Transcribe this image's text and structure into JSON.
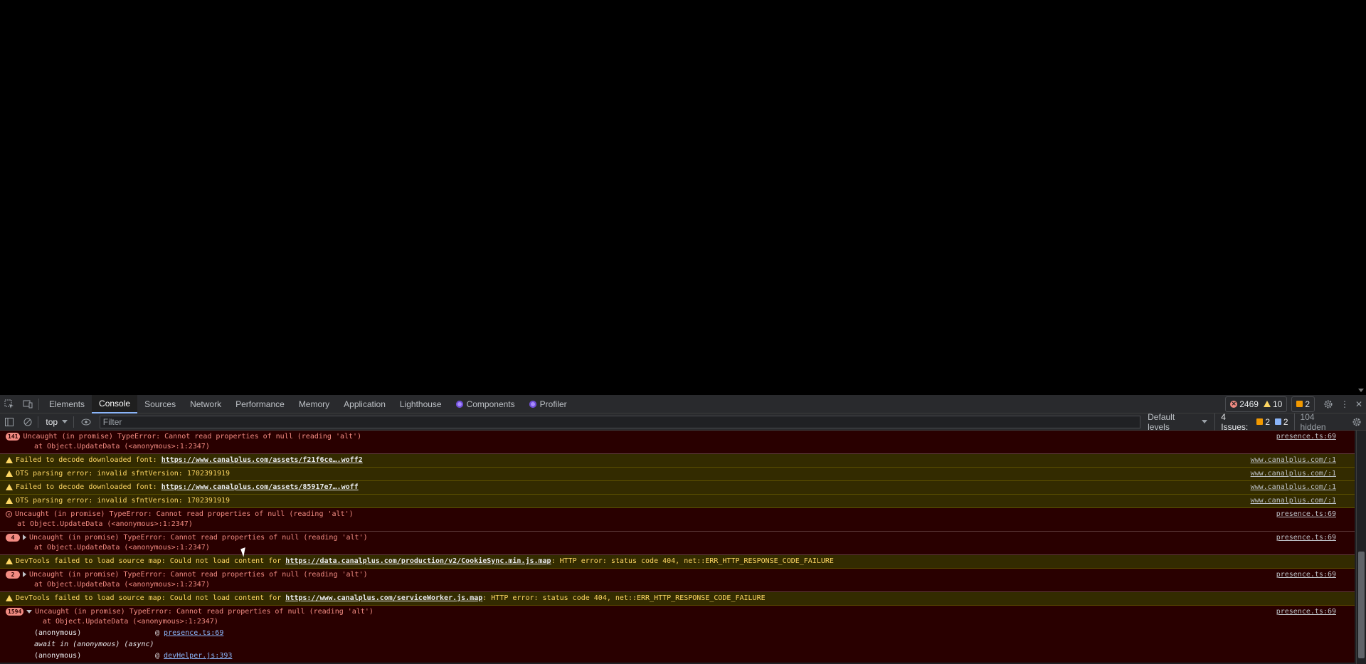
{
  "tabs": [
    {
      "label": "Elements",
      "active": false
    },
    {
      "label": "Console",
      "active": true
    },
    {
      "label": "Sources",
      "active": false
    },
    {
      "label": "Network",
      "active": false
    },
    {
      "label": "Performance",
      "active": false
    },
    {
      "label": "Memory",
      "active": false
    },
    {
      "label": "Application",
      "active": false
    },
    {
      "label": "Lighthouse",
      "active": false
    },
    {
      "label": "Components",
      "active": false
    },
    {
      "label": "Profiler",
      "active": false
    }
  ],
  "counters": {
    "errors": "2469",
    "warnings": "10",
    "issues": "2"
  },
  "toolbar": {
    "context": "top",
    "filter_placeholder": "Filter",
    "levels": "Default levels",
    "issues_label": "4 Issues:",
    "issues_warn": "2",
    "issues_info": "2",
    "hidden": "104 hidden"
  },
  "messages": [
    {
      "type": "error",
      "badge": "141",
      "text": "Uncaught (in promise) TypeError: Cannot read properties of null (reading 'alt')",
      "sub": "at Object.UpdateData (<anonymous>:1:2347)",
      "src": "presence.ts:69"
    },
    {
      "type": "warning",
      "pre": "Failed to decode downloaded font: ",
      "link": "https://www.canalplus.com/assets/f21f6ce….woff2",
      "post": "",
      "src": "www.canalplus.com/:1"
    },
    {
      "type": "warning",
      "pre": "OTS parsing error: invalid sfntVersion: 1702391919",
      "link": "",
      "post": "",
      "src": "www.canalplus.com/:1"
    },
    {
      "type": "warning",
      "pre": "Failed to decode downloaded font: ",
      "link": "https://www.canalplus.com/assets/85917e7….woff",
      "post": "",
      "src": "www.canalplus.com/:1"
    },
    {
      "type": "warning",
      "pre": "OTS parsing error: invalid sfntVersion: 1702391919",
      "link": "",
      "post": "",
      "src": "www.canalplus.com/:1"
    },
    {
      "type": "error",
      "icon": true,
      "text": "Uncaught (in promise) TypeError: Cannot read properties of null (reading 'alt')",
      "sub": "at Object.UpdateData (<anonymous>:1:2347)",
      "src": "presence.ts:69"
    },
    {
      "type": "error",
      "badge": "4",
      "tri": true,
      "text": "Uncaught (in promise) TypeError: Cannot read properties of null (reading 'alt')",
      "sub": "at Object.UpdateData (<anonymous>:1:2347)",
      "src": "presence.ts:69"
    },
    {
      "type": "warning",
      "pre": "DevTools failed to load source map: Could not load content for ",
      "link": "https://data.canalplus.com/production/v2/CookieSync.min.js.map",
      "post": ": HTTP error: status code 404, net::ERR_HTTP_RESPONSE_CODE_FAILURE",
      "src": ""
    },
    {
      "type": "error",
      "badge": "2",
      "tri": true,
      "text": "Uncaught (in promise) TypeError: Cannot read properties of null (reading 'alt')",
      "sub": "at Object.UpdateData (<anonymous>:1:2347)",
      "src": "presence.ts:69"
    },
    {
      "type": "warning",
      "pre": "DevTools failed to load source map: Could not load content for ",
      "link": "https://www.canalplus.com/serviceWorker.js.map",
      "post": ": HTTP error: status code 404, net::ERR_HTTP_RESPONSE_CODE_FAILURE",
      "src": ""
    }
  ],
  "expanded": {
    "badge": "1594",
    "text": "Uncaught (in promise) TypeError: Cannot read properties of null (reading 'alt')",
    "sub": "at Object.UpdateData (<anonymous>:1:2347)",
    "src": "presence.ts:69",
    "stack": [
      {
        "fn": "(anonymous)",
        "at": "@ ",
        "link": "presence.ts:69",
        "italic": false
      },
      {
        "fn": "await in (anonymous) (async)",
        "at": "",
        "link": "",
        "italic": true
      },
      {
        "fn": "(anonymous)",
        "at": "@ ",
        "link": "devHelper.js:393",
        "italic": false
      }
    ]
  }
}
